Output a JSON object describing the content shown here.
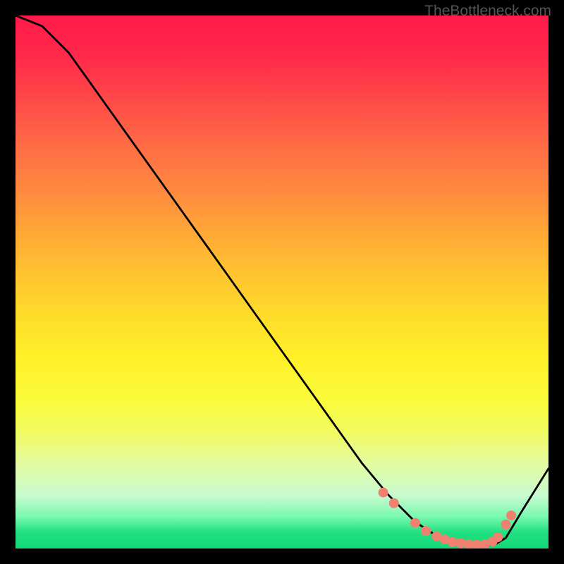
{
  "watermark": "TheBottleneck.com",
  "chart_data": {
    "type": "line",
    "title": "",
    "xlabel": "",
    "ylabel": "",
    "xlim": [
      0,
      100
    ],
    "ylim": [
      0,
      100
    ],
    "grid": false,
    "series": [
      {
        "name": "curve",
        "color": "#000000",
        "x": [
          0,
          5,
          10,
          15,
          20,
          25,
          30,
          35,
          40,
          45,
          50,
          55,
          60,
          65,
          70,
          75,
          78,
          80,
          82,
          85,
          88,
          90,
          92,
          95,
          100
        ],
        "y": [
          100,
          98,
          93,
          86,
          79,
          72,
          65,
          58,
          51,
          44,
          37,
          30,
          23,
          16,
          10,
          5,
          3,
          2,
          1.2,
          0.8,
          0.6,
          0.8,
          2,
          7,
          15
        ]
      }
    ],
    "markers": [
      {
        "name": "dots",
        "color": "#f08070",
        "points": [
          {
            "x": 69,
            "y": 10.5
          },
          {
            "x": 71,
            "y": 8.5
          },
          {
            "x": 75,
            "y": 4.8
          },
          {
            "x": 77,
            "y": 3.3
          },
          {
            "x": 79,
            "y": 2.3
          },
          {
            "x": 80.5,
            "y": 1.7
          },
          {
            "x": 82,
            "y": 1.2
          },
          {
            "x": 83.5,
            "y": 1.0
          },
          {
            "x": 85,
            "y": 0.8
          },
          {
            "x": 86.5,
            "y": 0.7
          },
          {
            "x": 88,
            "y": 0.8
          },
          {
            "x": 89.5,
            "y": 1.3
          },
          {
            "x": 90.5,
            "y": 2.1
          },
          {
            "x": 92,
            "y": 4.5
          },
          {
            "x": 93,
            "y": 6.2
          }
        ]
      }
    ]
  }
}
